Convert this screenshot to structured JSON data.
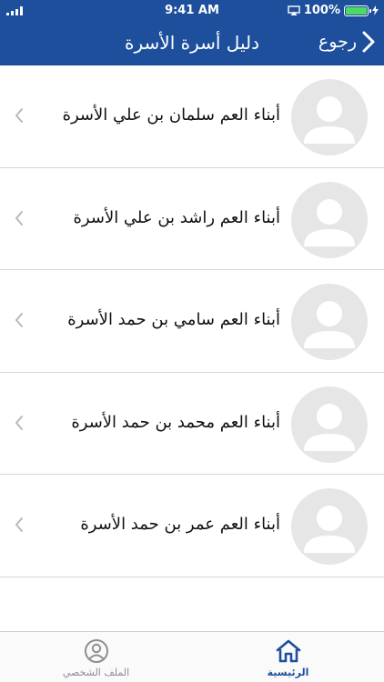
{
  "status_bar": {
    "time": "9:41 AM",
    "battery_percent": "100%",
    "battery_level": 1.0
  },
  "nav": {
    "title": "دليل أسرة الأسرة",
    "back_label": "رجوع"
  },
  "family_list": {
    "items": [
      {
        "name": "أبناء العم سلمان بن علي الأسرة"
      },
      {
        "name": "أبناء العم راشد بن علي الأسرة"
      },
      {
        "name": "أبناء العم سامي بن حمد الأسرة"
      },
      {
        "name": "أبناء العم محمد بن حمد الأسرة"
      },
      {
        "name": "أبناء العم عمر بن حمد الأسرة"
      }
    ]
  },
  "tabbar": {
    "home_label": "الرئيسية",
    "profile_label": "الملف الشخصي"
  },
  "colors": {
    "brand_blue": "#1d4f9c",
    "battery_green": "#4cd964",
    "avatar_bg": "#e6e6e6",
    "inactive_tab": "#8e8e93"
  },
  "icons": {
    "back": "chevron-right-icon",
    "row_disclosure": "chevron-left-icon",
    "avatar": "user-placeholder-icon",
    "home_tab": "home-icon",
    "profile_tab": "user-circle-icon"
  }
}
